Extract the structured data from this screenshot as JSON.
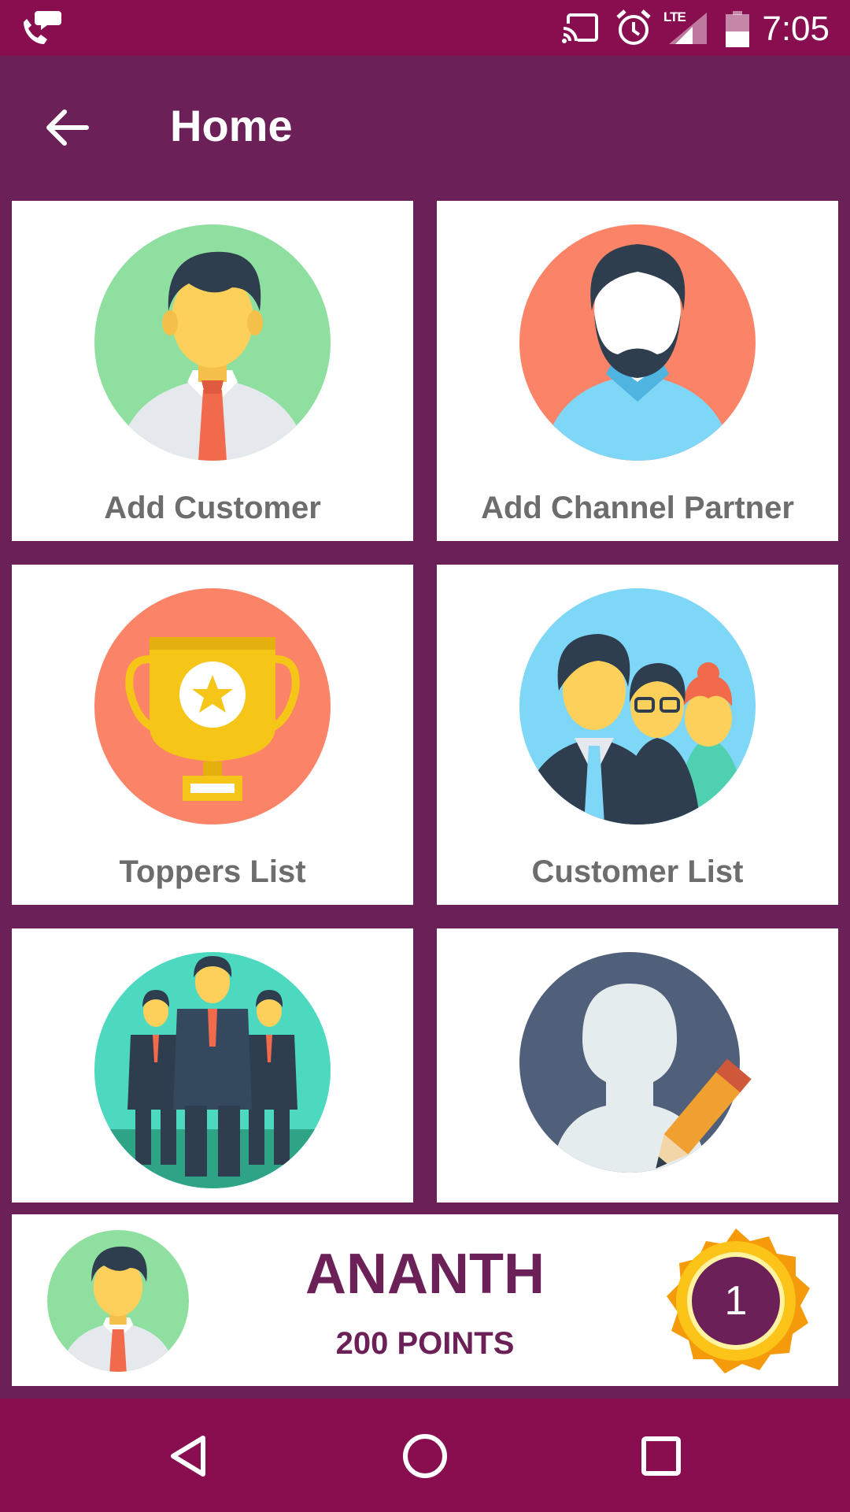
{
  "status_bar": {
    "time": "7:05",
    "network": "LTE",
    "icons": [
      "chat-phone-icon",
      "cast-icon",
      "alarm-icon",
      "signal-icon",
      "battery-icon"
    ]
  },
  "app_bar": {
    "title": "Home",
    "back_icon": "arrow-back-icon"
  },
  "menu": {
    "items": [
      {
        "label": "Add Customer",
        "icon": "businessman-avatar-icon"
      },
      {
        "label": "Add Channel Partner",
        "icon": "bearded-man-avatar-icon"
      },
      {
        "label": "Toppers List",
        "icon": "trophy-icon"
      },
      {
        "label": "Customer List",
        "icon": "people-group-icon"
      },
      {
        "label": "",
        "icon": "team-businessmen-icon"
      },
      {
        "label": "",
        "icon": "edit-profile-icon"
      }
    ]
  },
  "user": {
    "name": "ANANTH",
    "points": "200 POINTS",
    "rank": "1"
  },
  "nav_bar": {
    "icons": [
      "nav-back-icon",
      "nav-home-icon",
      "nav-recent-icon"
    ]
  },
  "colors": {
    "status_bar": "#880e4f",
    "primary": "#6b2157",
    "card": "#ffffff",
    "label_gray": "#6d6d6d"
  }
}
